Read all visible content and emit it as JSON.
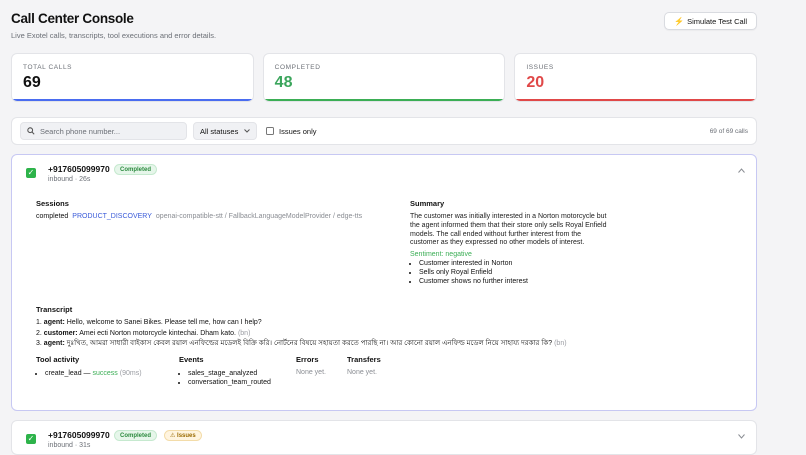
{
  "header": {
    "title": "Call Center Console",
    "subtitle": "Live Exotel calls, transcripts, tool executions and error details.",
    "simulate_label": "Simulate Test Call",
    "simulate_icon": "⚡"
  },
  "stats": [
    {
      "label": "TOTAL CALLS",
      "value": "69",
      "color": "#111111",
      "bar": "#4a6cf0"
    },
    {
      "label": "COMPLETED",
      "value": "48",
      "color": "#3ba55c",
      "bar": "#3bae55"
    },
    {
      "label": "ISSUES",
      "value": "20",
      "color": "#e04848",
      "bar": "#e04848"
    }
  ],
  "filters": {
    "search_placeholder": "Search phone number...",
    "status_value": "All statuses",
    "issues_only_label": "Issues only",
    "count_text": "69 of 69 calls"
  },
  "calls": [
    {
      "phone": "+917605099970",
      "meta": "inbound · 26s",
      "status_badge": "Completed",
      "sessions_title": "Sessions",
      "session": {
        "status": "completed",
        "stage": "PRODUCT_DISCOVERY",
        "providers": "openai-compatible-stt / FallbackLanguageModelProvider / edge-tts"
      },
      "summary_title": "Summary",
      "summary_text": "The customer was initially interested in a Norton motorcycle but the agent informed them that their store only sells Royal Enfield models. The call ended without further interest from the customer as they expressed no other models of interest.",
      "sentiment": "Sentiment: negative",
      "summary_points": [
        "Customer interested in Norton",
        "Sells only Royal Enfield",
        "Customer shows no further interest"
      ],
      "transcript_title": "Transcript",
      "transcript": [
        {
          "n": "1.",
          "speaker": "agent:",
          "text": "Hello, welcome to Sanei Bikes. Please tell me, how can I help?",
          "lang": ""
        },
        {
          "n": "2.",
          "speaker": "customer:",
          "text": "Amei ecti Norton motorcycle kintechai. Dham kato.",
          "lang": "(bn)"
        },
        {
          "n": "3.",
          "speaker": "agent:",
          "text": "দুঃখিত, আমরা সাধারী বাইকাস কেবল রয়াল এনফিল্ডের মডেলই বিক্রি করি। নোর্টনের বিষয়ে সহায়তা করতে পারছি না। আর কোনো রয়াল এনফিল্ড মডেল নিয়ে সাহায্য দরকার কি?",
          "lang": "(bn)"
        }
      ],
      "tool_activity_title": "Tool activity",
      "tool": {
        "name": "create_lead",
        "dash": "—",
        "result": "success",
        "time": "(90ms)"
      },
      "events_title": "Events",
      "events": [
        "sales_stage_analyzed",
        "conversation_team_routed"
      ],
      "errors_title": "Errors",
      "errors_value": "None yet.",
      "transfers_title": "Transfers",
      "transfers_value": "None yet."
    },
    {
      "phone": "+917605099970",
      "meta": "inbound · 31s",
      "status_badge": "Completed",
      "issue_badge": "⚠ Issues"
    }
  ]
}
